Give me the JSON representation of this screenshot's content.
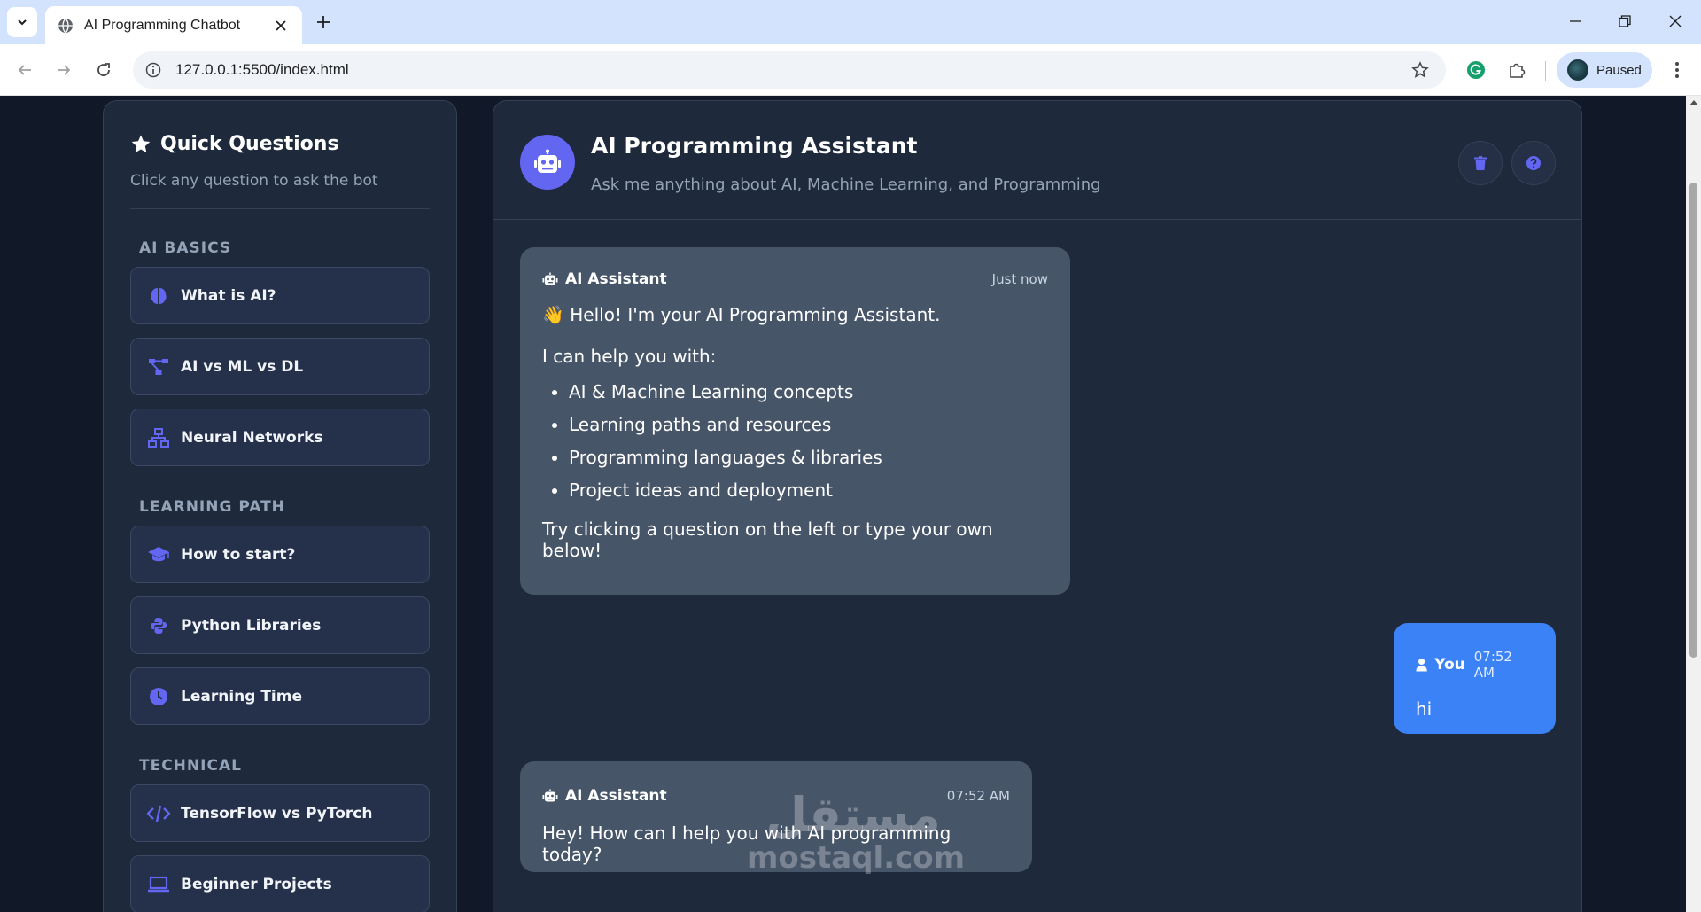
{
  "browser": {
    "tab_title": "AI Programming Chatbot",
    "url": "127.0.0.1:5500/index.html",
    "profile_label": "Paused"
  },
  "sidebar": {
    "title": "Quick Questions",
    "subtitle": "Click any question to ask the bot",
    "sections": [
      {
        "heading": "AI BASICS",
        "items": [
          {
            "label": "What is AI?",
            "icon": "brain-icon"
          },
          {
            "label": "AI vs ML vs DL",
            "icon": "diagram-icon"
          },
          {
            "label": "Neural Networks",
            "icon": "network-icon"
          }
        ]
      },
      {
        "heading": "LEARNING PATH",
        "items": [
          {
            "label": "How to start?",
            "icon": "graduation-cap-icon"
          },
          {
            "label": "Python Libraries",
            "icon": "python-icon"
          },
          {
            "label": "Learning Time",
            "icon": "clock-icon"
          }
        ]
      },
      {
        "heading": "TECHNICAL",
        "items": [
          {
            "label": "TensorFlow vs PyTorch",
            "icon": "code-icon"
          },
          {
            "label": "Beginner Projects",
            "icon": "laptop-icon"
          }
        ]
      }
    ]
  },
  "chat": {
    "title": "AI Programming Assistant",
    "subtitle": "Ask me anything about AI, Machine Learning, and Programming",
    "messages": [
      {
        "author": "AI Assistant",
        "time": "Just now",
        "greeting": "👋 Hello! I'm your AI Programming Assistant.",
        "intro": "I can help you with:",
        "bullets": [
          "AI & Machine Learning concepts",
          "Learning paths and resources",
          "Programming languages & libraries",
          "Project ideas and deployment"
        ],
        "outro": "Try clicking a question on the left or type your own below!"
      },
      {
        "author": "You",
        "time": "07:52 AM",
        "text": "hi"
      },
      {
        "author": "AI Assistant",
        "time": "07:52 AM",
        "text": "Hey! How can I help you with AI programming today?"
      }
    ]
  },
  "watermark": {
    "arabic": "مستقل",
    "latin": "mostaql.com"
  },
  "colors": {
    "accent": "#6366f1",
    "user_bubble": "#3b82f6",
    "bot_bubble": "#475569",
    "panel": "#1e293b"
  }
}
